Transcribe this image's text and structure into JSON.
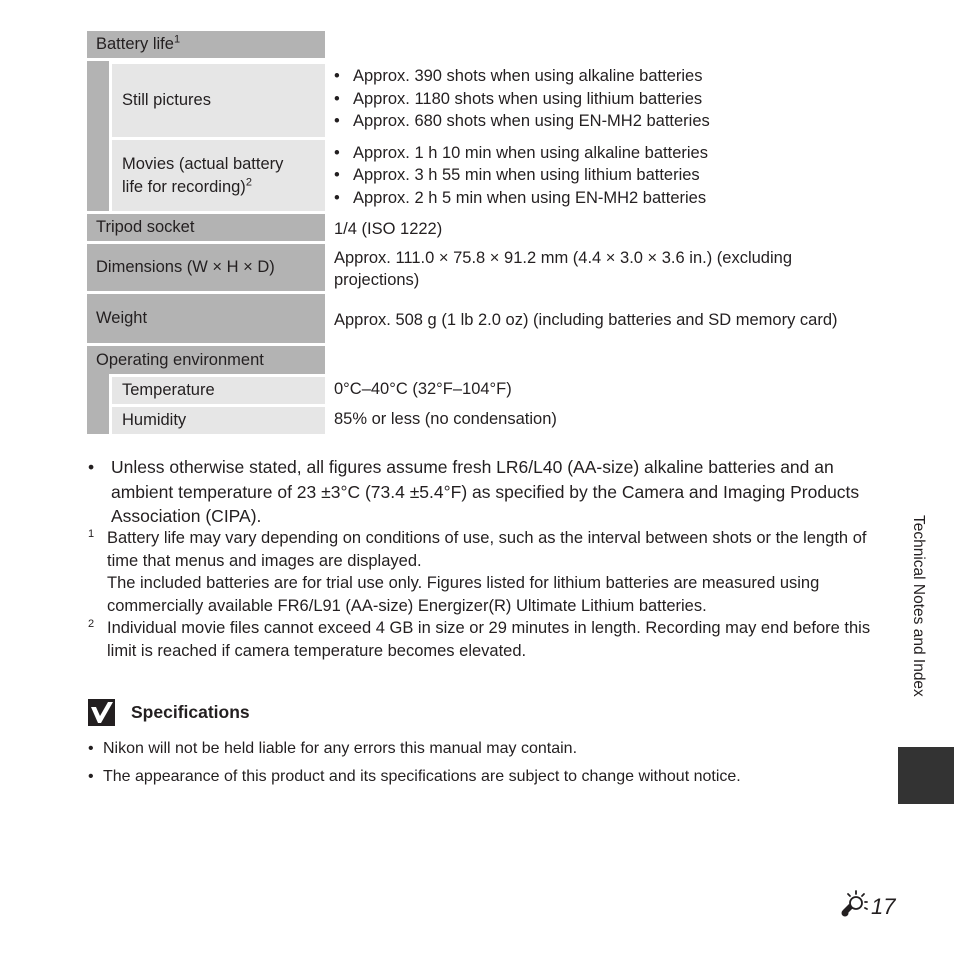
{
  "table": {
    "battery_life": {
      "label": "Battery life",
      "footnote_ref": "1",
      "still_pictures": {
        "label": "Still pictures",
        "values": [
          "Approx. 390 shots when using alkaline batteries",
          "Approx. 1180 shots when using lithium batteries",
          "Approx. 680 shots when using EN-MH2 batteries"
        ]
      },
      "movies": {
        "label_line1": "Movies (actual battery",
        "label_line2": "life for recording)",
        "footnote_ref": "2",
        "values": [
          "Approx. 1 h 10 min when using alkaline batteries",
          "Approx. 3 h 55 min when using lithium batteries",
          "Approx. 2 h 5 min when using EN-MH2 batteries"
        ]
      }
    },
    "tripod_socket": {
      "label": "Tripod socket",
      "value": "1/4 (ISO 1222)"
    },
    "dimensions": {
      "label": "Dimensions (W × H × D)",
      "value": "Approx. 111.0 × 75.8 × 91.2 mm (4.4 × 3.0 × 3.6 in.) (excluding projections)"
    },
    "weight": {
      "label": "Weight",
      "value": "Approx. 508 g (1 lb 2.0 oz) (including batteries and SD memory card)"
    },
    "operating_environment": {
      "label": "Operating environment",
      "temperature": {
        "label": "Temperature",
        "value": "0°C–40°C (32°F–104°F)"
      },
      "humidity": {
        "label": "Humidity",
        "value": "85% or less (no condensation)"
      }
    }
  },
  "notes": {
    "bullet": "Unless otherwise stated, all figures assume fresh LR6/L40 (AA-size) alkaline batteries and an ambient temperature of 23 ±3°C (73.4 ±5.4°F) as specified by the Camera and Imaging Products Association (CIPA).",
    "footnotes": [
      {
        "mark": "1",
        "paragraphs": [
          "Battery life may vary depending on conditions of use, such as the interval between shots or the length of time that menus and images are displayed.",
          "The included batteries are for trial use only. Figures listed for lithium batteries are measured using commercially available FR6/L91 (AA-size) Energizer(R) Ultimate Lithium batteries."
        ]
      },
      {
        "mark": "2",
        "paragraphs": [
          "Individual movie files cannot exceed 4 GB in size or 29 minutes in length. Recording may end before this limit is reached if camera temperature becomes elevated."
        ]
      }
    ]
  },
  "callout": {
    "icon": "check-icon",
    "title": "Specifications",
    "items": [
      "Nikon will not be held liable for any errors this manual may contain.",
      "The appearance of this product and its specifications are subject to change without notice."
    ]
  },
  "side_tab": {
    "label": "Technical Notes and Index",
    "color": "#333333"
  },
  "page": {
    "icon": "lightbulb-icon",
    "number": "17"
  },
  "colors": {
    "label_dark": "#b3b3b3",
    "label_light": "#e6e6e6",
    "text": "#231f20"
  }
}
